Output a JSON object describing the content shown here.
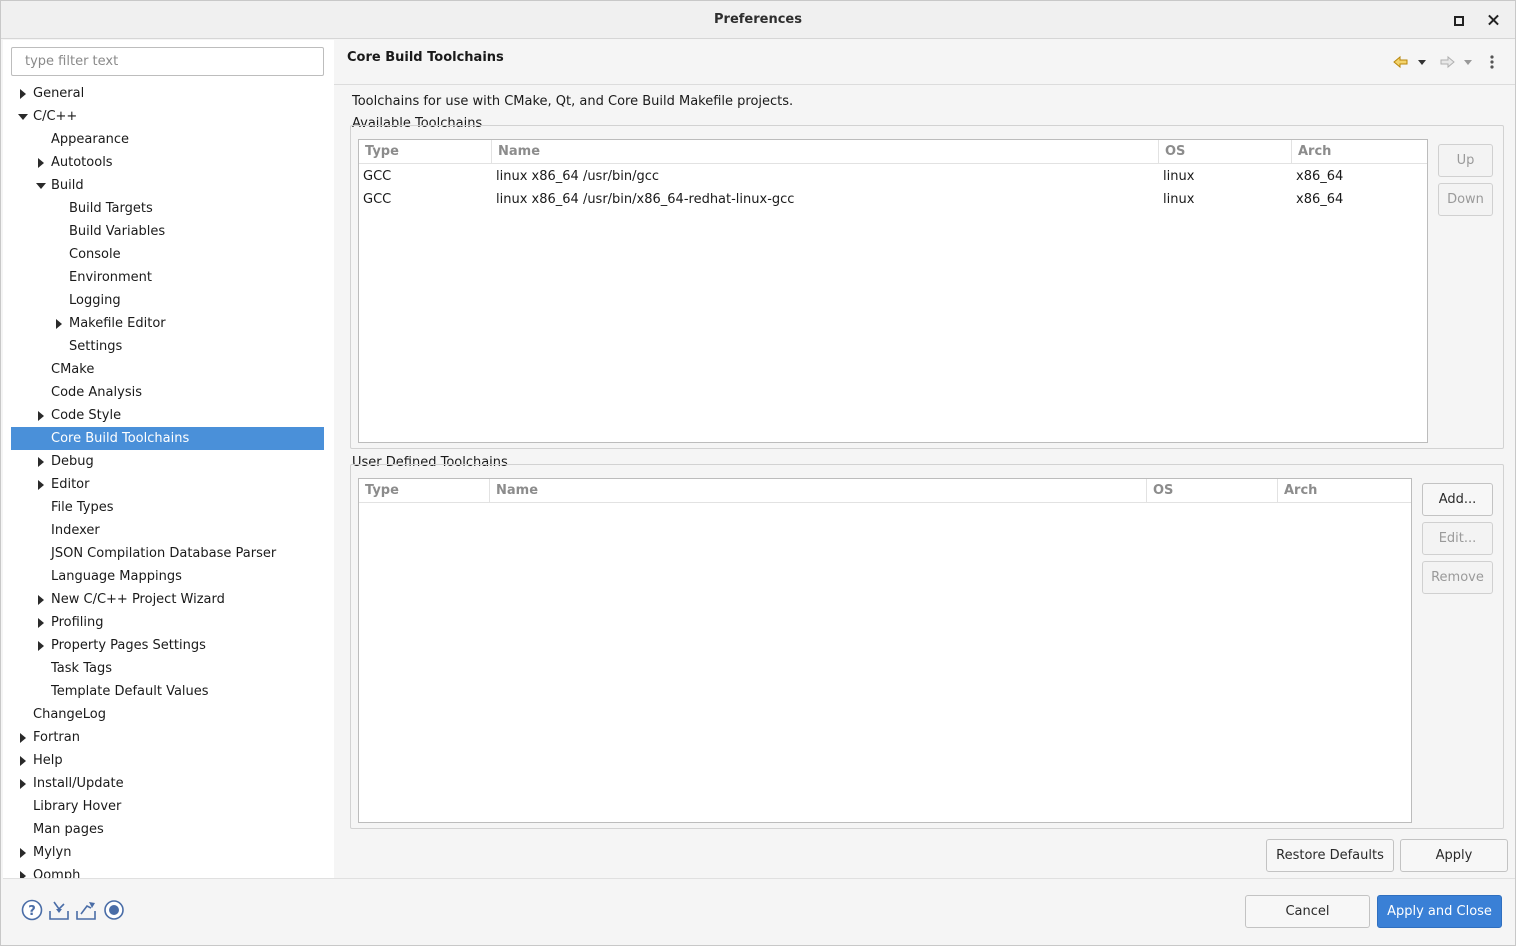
{
  "window": {
    "title": "Preferences"
  },
  "filter": {
    "placeholder": "type filter text"
  },
  "tree": [
    {
      "label": "General",
      "level": 0,
      "arrow": "right"
    },
    {
      "label": "C/C++",
      "level": 0,
      "arrow": "down"
    },
    {
      "label": "Appearance",
      "level": 1,
      "arrow": ""
    },
    {
      "label": "Autotools",
      "level": 1,
      "arrow": "right"
    },
    {
      "label": "Build",
      "level": 1,
      "arrow": "down"
    },
    {
      "label": "Build Targets",
      "level": 2,
      "arrow": ""
    },
    {
      "label": "Build Variables",
      "level": 2,
      "arrow": ""
    },
    {
      "label": "Console",
      "level": 2,
      "arrow": ""
    },
    {
      "label": "Environment",
      "level": 2,
      "arrow": ""
    },
    {
      "label": "Logging",
      "level": 2,
      "arrow": ""
    },
    {
      "label": "Makefile Editor",
      "level": 2,
      "arrow": "right"
    },
    {
      "label": "Settings",
      "level": 2,
      "arrow": ""
    },
    {
      "label": "CMake",
      "level": 1,
      "arrow": ""
    },
    {
      "label": "Code Analysis",
      "level": 1,
      "arrow": ""
    },
    {
      "label": "Code Style",
      "level": 1,
      "arrow": "right"
    },
    {
      "label": "Core Build Toolchains",
      "level": 1,
      "arrow": "",
      "selected": true
    },
    {
      "label": "Debug",
      "level": 1,
      "arrow": "right"
    },
    {
      "label": "Editor",
      "level": 1,
      "arrow": "right"
    },
    {
      "label": "File Types",
      "level": 1,
      "arrow": ""
    },
    {
      "label": "Indexer",
      "level": 1,
      "arrow": ""
    },
    {
      "label": "JSON Compilation Database Parser",
      "level": 1,
      "arrow": ""
    },
    {
      "label": "Language Mappings",
      "level": 1,
      "arrow": ""
    },
    {
      "label": "New C/C++ Project Wizard",
      "level": 1,
      "arrow": "right"
    },
    {
      "label": "Profiling",
      "level": 1,
      "arrow": "right"
    },
    {
      "label": "Property Pages Settings",
      "level": 1,
      "arrow": "right"
    },
    {
      "label": "Task Tags",
      "level": 1,
      "arrow": ""
    },
    {
      "label": "Template Default Values",
      "level": 1,
      "arrow": ""
    },
    {
      "label": "ChangeLog",
      "level": 0,
      "arrow": ""
    },
    {
      "label": "Fortran",
      "level": 0,
      "arrow": "right"
    },
    {
      "label": "Help",
      "level": 0,
      "arrow": "right"
    },
    {
      "label": "Install/Update",
      "level": 0,
      "arrow": "right"
    },
    {
      "label": "Library Hover",
      "level": 0,
      "arrow": ""
    },
    {
      "label": "Man pages",
      "level": 0,
      "arrow": ""
    },
    {
      "label": "Mylyn",
      "level": 0,
      "arrow": "right"
    },
    {
      "label": "Oomph",
      "level": 0,
      "arrow": "right"
    }
  ],
  "page": {
    "title": "Core Build Toolchains",
    "description": "Toolchains for use with CMake, Qt, and Core Build Makefile projects."
  },
  "available": {
    "label": "Available Toolchains",
    "columns": [
      "Type",
      "Name",
      "OS",
      "Arch"
    ],
    "rows": [
      [
        "GCC",
        "linux x86_64 /usr/bin/gcc",
        "linux",
        "x86_64"
      ],
      [
        "GCC",
        "linux x86_64 /usr/bin/x86_64-redhat-linux-gcc",
        "linux",
        "x86_64"
      ]
    ],
    "up_label": "Up",
    "down_label": "Down"
  },
  "user": {
    "label": "User Defined Toolchains",
    "columns": [
      "Type",
      "Name",
      "OS",
      "Arch"
    ],
    "add_label": "Add...",
    "edit_label": "Edit...",
    "remove_label": "Remove"
  },
  "buttons": {
    "restore_defaults": "Restore Defaults",
    "apply": "Apply",
    "cancel": "Cancel",
    "apply_and_close": "Apply and Close"
  },
  "colors": {
    "selection": "#4a90d9",
    "primary_button": "#3a80d6",
    "nav_arrow": "#e8b800"
  }
}
